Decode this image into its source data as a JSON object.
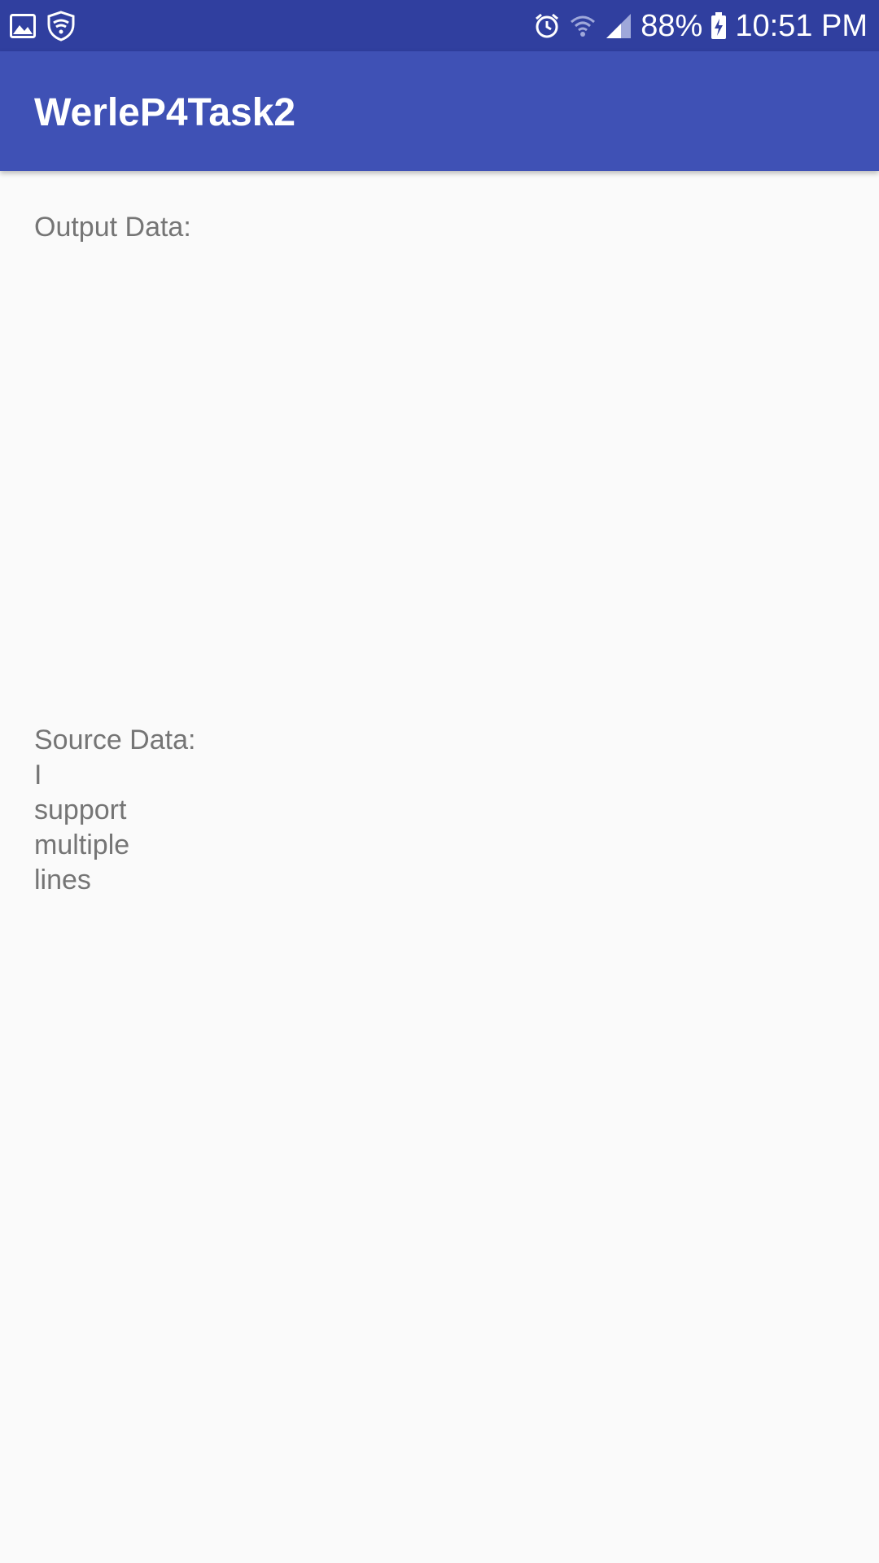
{
  "status_bar": {
    "left_icons": [
      "gallery-icon",
      "shield-icon"
    ],
    "right_icons": [
      "alarm-icon",
      "wifi-icon",
      "signal-icon",
      "battery-charging-icon"
    ],
    "battery_percent": "88%",
    "time": "10:51 PM"
  },
  "app_bar": {
    "title": "WerleP4Task2",
    "color": "#3f51b5",
    "status_color": "#303f9f"
  },
  "main": {
    "output_label": "Output Data:",
    "source_label": "Source Data:",
    "source_lines": [
      "I",
      "support",
      "multiple",
      "lines"
    ]
  }
}
